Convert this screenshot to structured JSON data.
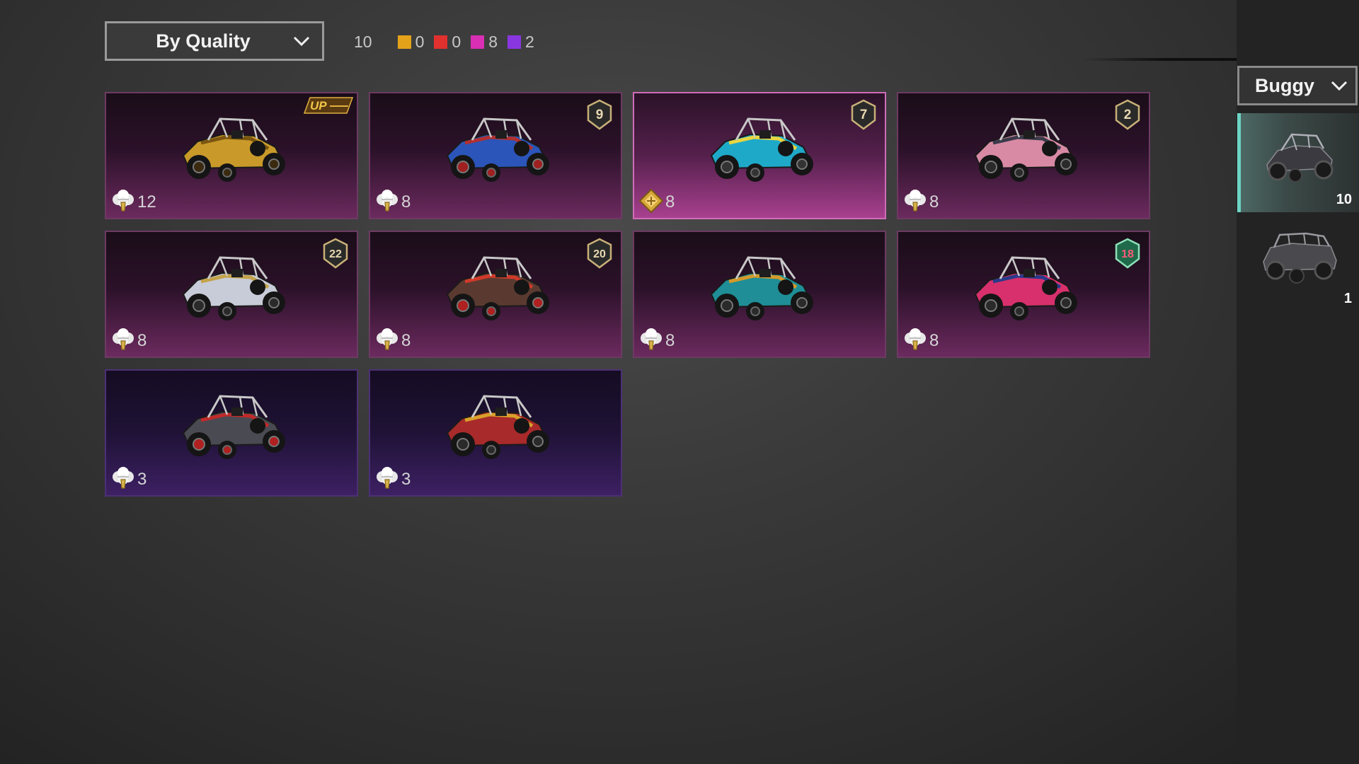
{
  "toolbar": {
    "sort_label": "By Quality",
    "total_count": "10",
    "quality_counts": [
      {
        "color": "#e3a21a",
        "count": "0"
      },
      {
        "color": "#e0312f",
        "count": "0"
      },
      {
        "color": "#d82fb4",
        "count": "8"
      },
      {
        "color": "#8a36e0",
        "count": "2"
      }
    ],
    "close_icon": "close-icon"
  },
  "sidebar": {
    "vehicle_filter_label": "Buggy",
    "tabs": [
      {
        "count": "10",
        "active": true,
        "icon": "buggy-icon"
      },
      {
        "count": "1",
        "active": false,
        "icon": "pickup-truck-icon"
      }
    ]
  },
  "items": [
    {
      "badge": "UP",
      "badge_type": "upgrade",
      "currency_icon": "fortune-currency-icon",
      "amount": "12",
      "quality": "pink",
      "body": "#c99a2a",
      "accent": "#7a5510",
      "wheel": "#3a2a10"
    },
    {
      "badge": "9",
      "badge_type": "level",
      "currency_icon": "fortune-currency-icon",
      "amount": "8",
      "quality": "pink",
      "body": "#2b55b8",
      "accent": "#b03030",
      "wheel": "#a02020"
    },
    {
      "badge": "7",
      "badge_type": "level",
      "currency_icon": "gold-diamond-icon",
      "amount": "8",
      "quality": "pink",
      "selected": true,
      "body": "#1fa9c9",
      "accent": "#e8d640",
      "wheel": "#333333"
    },
    {
      "badge": "2",
      "badge_type": "level",
      "currency_icon": "fortune-currency-icon",
      "amount": "8",
      "quality": "pink",
      "body": "#d88aa4",
      "accent": "#3a3a4a",
      "wheel": "#2a2a2a"
    },
    {
      "badge": "22",
      "badge_type": "level",
      "currency_icon": "fortune-currency-icon",
      "amount": "8",
      "quality": "pink",
      "body": "#c8ccd8",
      "accent": "#c4a24a",
      "wheel": "#2a2a2a"
    },
    {
      "badge": "20",
      "badge_type": "level",
      "currency_icon": "fortune-currency-icon",
      "amount": "8",
      "quality": "pink",
      "body": "#5a3a30",
      "accent": "#d03a2a",
      "wheel": "#b02020"
    },
    {
      "badge": "",
      "badge_type": "none",
      "currency_icon": "fortune-currency-icon",
      "amount": "8",
      "quality": "pink",
      "body": "#1f8e96",
      "accent": "#d49a2a",
      "wheel": "#2a2a2a"
    },
    {
      "badge": "18",
      "badge_type": "level-special",
      "currency_icon": "fortune-currency-icon",
      "amount": "8",
      "quality": "pink",
      "body": "#d8306c",
      "accent": "#2a3a8a",
      "wheel": "#2a2a2a"
    },
    {
      "badge": "",
      "badge_type": "none",
      "currency_icon": "fortune-currency-icon",
      "amount": "3",
      "quality": "purple",
      "body": "#4a4a52",
      "accent": "#c02a2a",
      "wheel": "#b02020"
    },
    {
      "badge": "",
      "badge_type": "none",
      "currency_icon": "fortune-currency-icon",
      "amount": "3",
      "quality": "purple",
      "body": "#a82a2a",
      "accent": "#d8a02a",
      "wheel": "#2a2a2a"
    }
  ]
}
